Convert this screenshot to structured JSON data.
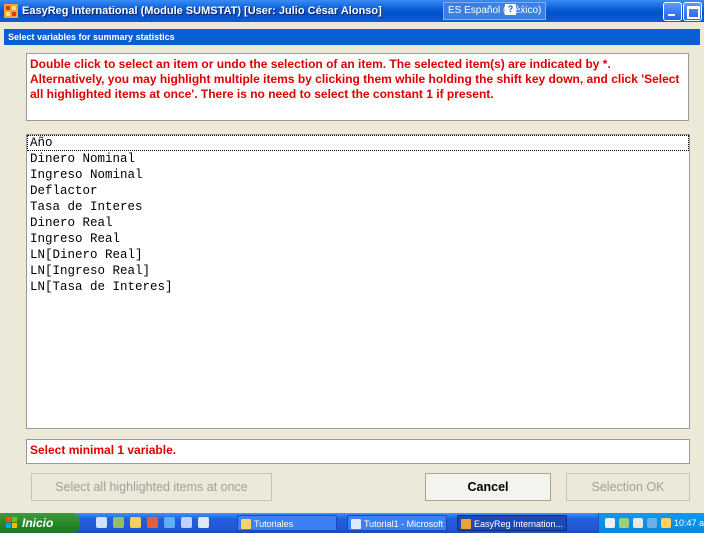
{
  "window": {
    "title": "EasyReg International (Module SUMSTAT) [User: Julio César Alonso]",
    "language": "ES Español (México)",
    "language_help": "?",
    "language_options": ":"
  },
  "dialog": {
    "caption": "Select variables for summary statistics",
    "instructions": "Double click to select an item or undo the selection of an item. The selected item(s) are indicated by *. Alternatively, you may highlight multiple items by clicking them while holding the shift key down, and click 'Select all highlighted items at once'. There is no need to select the constant 1 if present.",
    "variables": [
      "Año",
      "Dinero Nominal",
      "Ingreso Nominal",
      "Deflactor",
      "Tasa de Interes",
      "Dinero Real",
      "Ingreso Real",
      "LN[Dinero Real]",
      "LN[Ingreso Real]",
      "LN[Tasa de Interes]"
    ],
    "status": "Select minimal 1 variable.",
    "buttons": {
      "select_all": "Select all highlighted items at once",
      "cancel": "Cancel",
      "ok": "Selection OK"
    }
  },
  "taskbar": {
    "start": "Inicio",
    "tasks": [
      "Tutoriales",
      "Tutorial1 - Microsoft ...",
      "EasyReg Internation..."
    ],
    "clock": "10:47 a.m."
  },
  "colors": {
    "instruction_text": "#e00000",
    "titlebar": "#0a5fd8",
    "dialog_caption": "#0b5fd4"
  }
}
